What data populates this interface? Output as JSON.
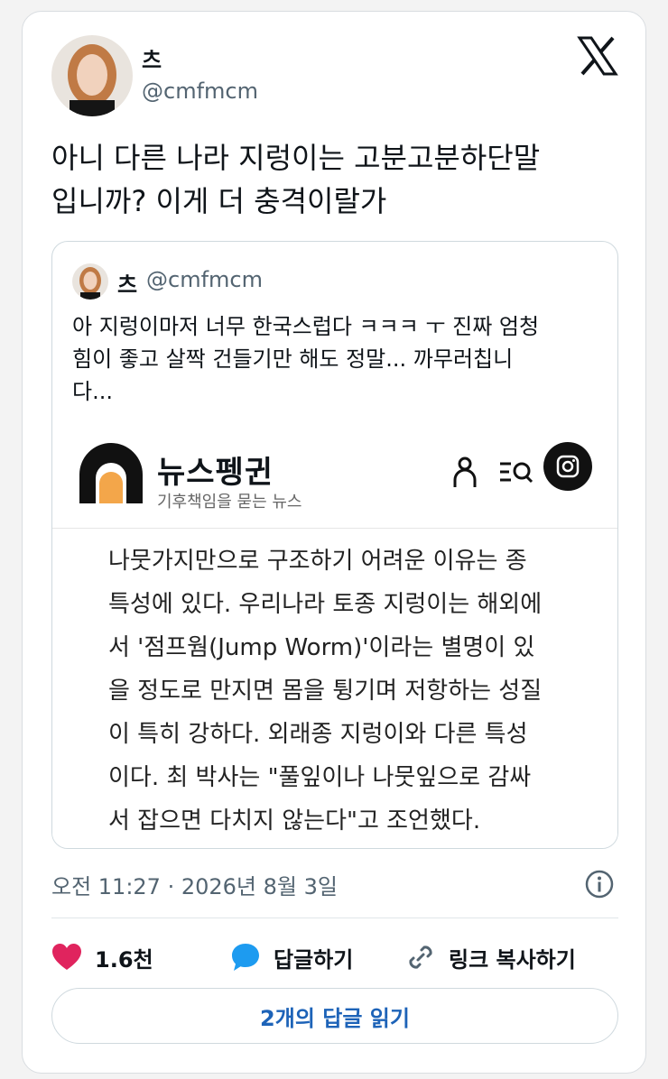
{
  "tweet": {
    "display_name": "츠",
    "handle": "@cmfmcm",
    "text_lines": [
      "아니 다른 나라 지렁이는 고분고분하단말",
      "입니까? 이게 더 충격이랄가"
    ],
    "timestamp": "오전 11:27 · 2026년 8월 3일"
  },
  "quote": {
    "display_name": "츠",
    "handle": "@cmfmcm",
    "text_lines": [
      "아 지렁이마저 너무 한국스럽다 ㅋㅋㅋ ㅜ 진짜 엄청",
      "힘이 좋고 살짝 건들기만 해도 정말... 까무러칩니",
      "다..."
    ]
  },
  "article": {
    "brand": "뉴스펭귄",
    "tagline": "기후책임을 묻는 뉴스",
    "body_lines": [
      "나뭇가지만으로 구조하기 어려운 이유는 종",
      "특성에 있다. 우리나라 토종 지렁이는 해외에",
      "서 '점프웜(Jump Worm)'이라는 별명이 있",
      "을 정도로 만지면 몸을 튕기며 저항하는 성질",
      "이 특히 강하다. 외래종 지렁이와 다른 특성",
      "이다. 최 박사는 \"풀잎이나 나뭇잎으로 감싸",
      "서 잡으면 다치지 않는다\"고 조언했다."
    ]
  },
  "actions": {
    "like_count": "1.6천",
    "reply_label": "답글하기",
    "copy_link_label": "링크 복사하기",
    "read_replies_label": "2개의 답글 읽기"
  },
  "colors": {
    "like": "#e0245e",
    "reply": "#1d9bf0",
    "link_text": "#1d63b8",
    "news_logo_orange": "#f3a64a"
  },
  "icons": [
    "x-logo-icon",
    "person-icon",
    "menu-search-icon",
    "instagram-icon",
    "info-icon",
    "heart-icon",
    "speech-bubble-icon",
    "link-icon"
  ]
}
